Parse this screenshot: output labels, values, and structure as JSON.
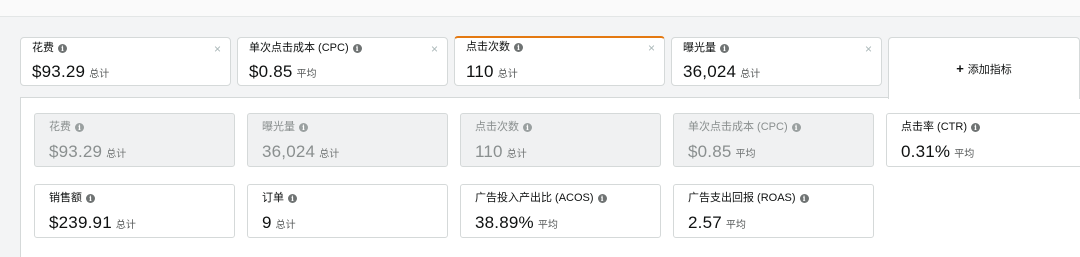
{
  "top_cards": [
    {
      "label": "花费",
      "value": "$93.29",
      "unit": "总计",
      "close": "×"
    },
    {
      "label": "单次点击成本 (CPC)",
      "value": "$0.85",
      "unit": "平均",
      "close": "×"
    },
    {
      "label": "点击次数",
      "value": "110",
      "unit": "总计",
      "close": "×"
    },
    {
      "label": "曝光量",
      "value": "36,024",
      "unit": "总计",
      "close": "×"
    }
  ],
  "add_metric": {
    "icon": "+",
    "label": "添加指标"
  },
  "info_icon": "i",
  "metric_row1": [
    {
      "label": "花费",
      "value": "$93.29",
      "unit": "总计"
    },
    {
      "label": "曝光量",
      "value": "36,024",
      "unit": "总计"
    },
    {
      "label": "点击次数",
      "value": "110",
      "unit": "总计"
    },
    {
      "label": "单次点击成本 (CPC)",
      "value": "$0.85",
      "unit": "平均"
    },
    {
      "label": "点击率 (CTR)",
      "value": "0.31%",
      "unit": "平均"
    }
  ],
  "metric_row2": [
    {
      "label": "销售额",
      "value": "$239.91",
      "unit": "总计"
    },
    {
      "label": "订单",
      "value": "9",
      "unit": "总计"
    },
    {
      "label": "广告投入产出比 (ACOS)",
      "value": "38.89%",
      "unit": "平均"
    },
    {
      "label": "广告支出回报 (ROAS)",
      "value": "2.57",
      "unit": "平均"
    }
  ],
  "colors": {
    "active_accent": "#e47911",
    "disabled_bg": "#f0f1f2",
    "border": "#d5d9d9"
  }
}
